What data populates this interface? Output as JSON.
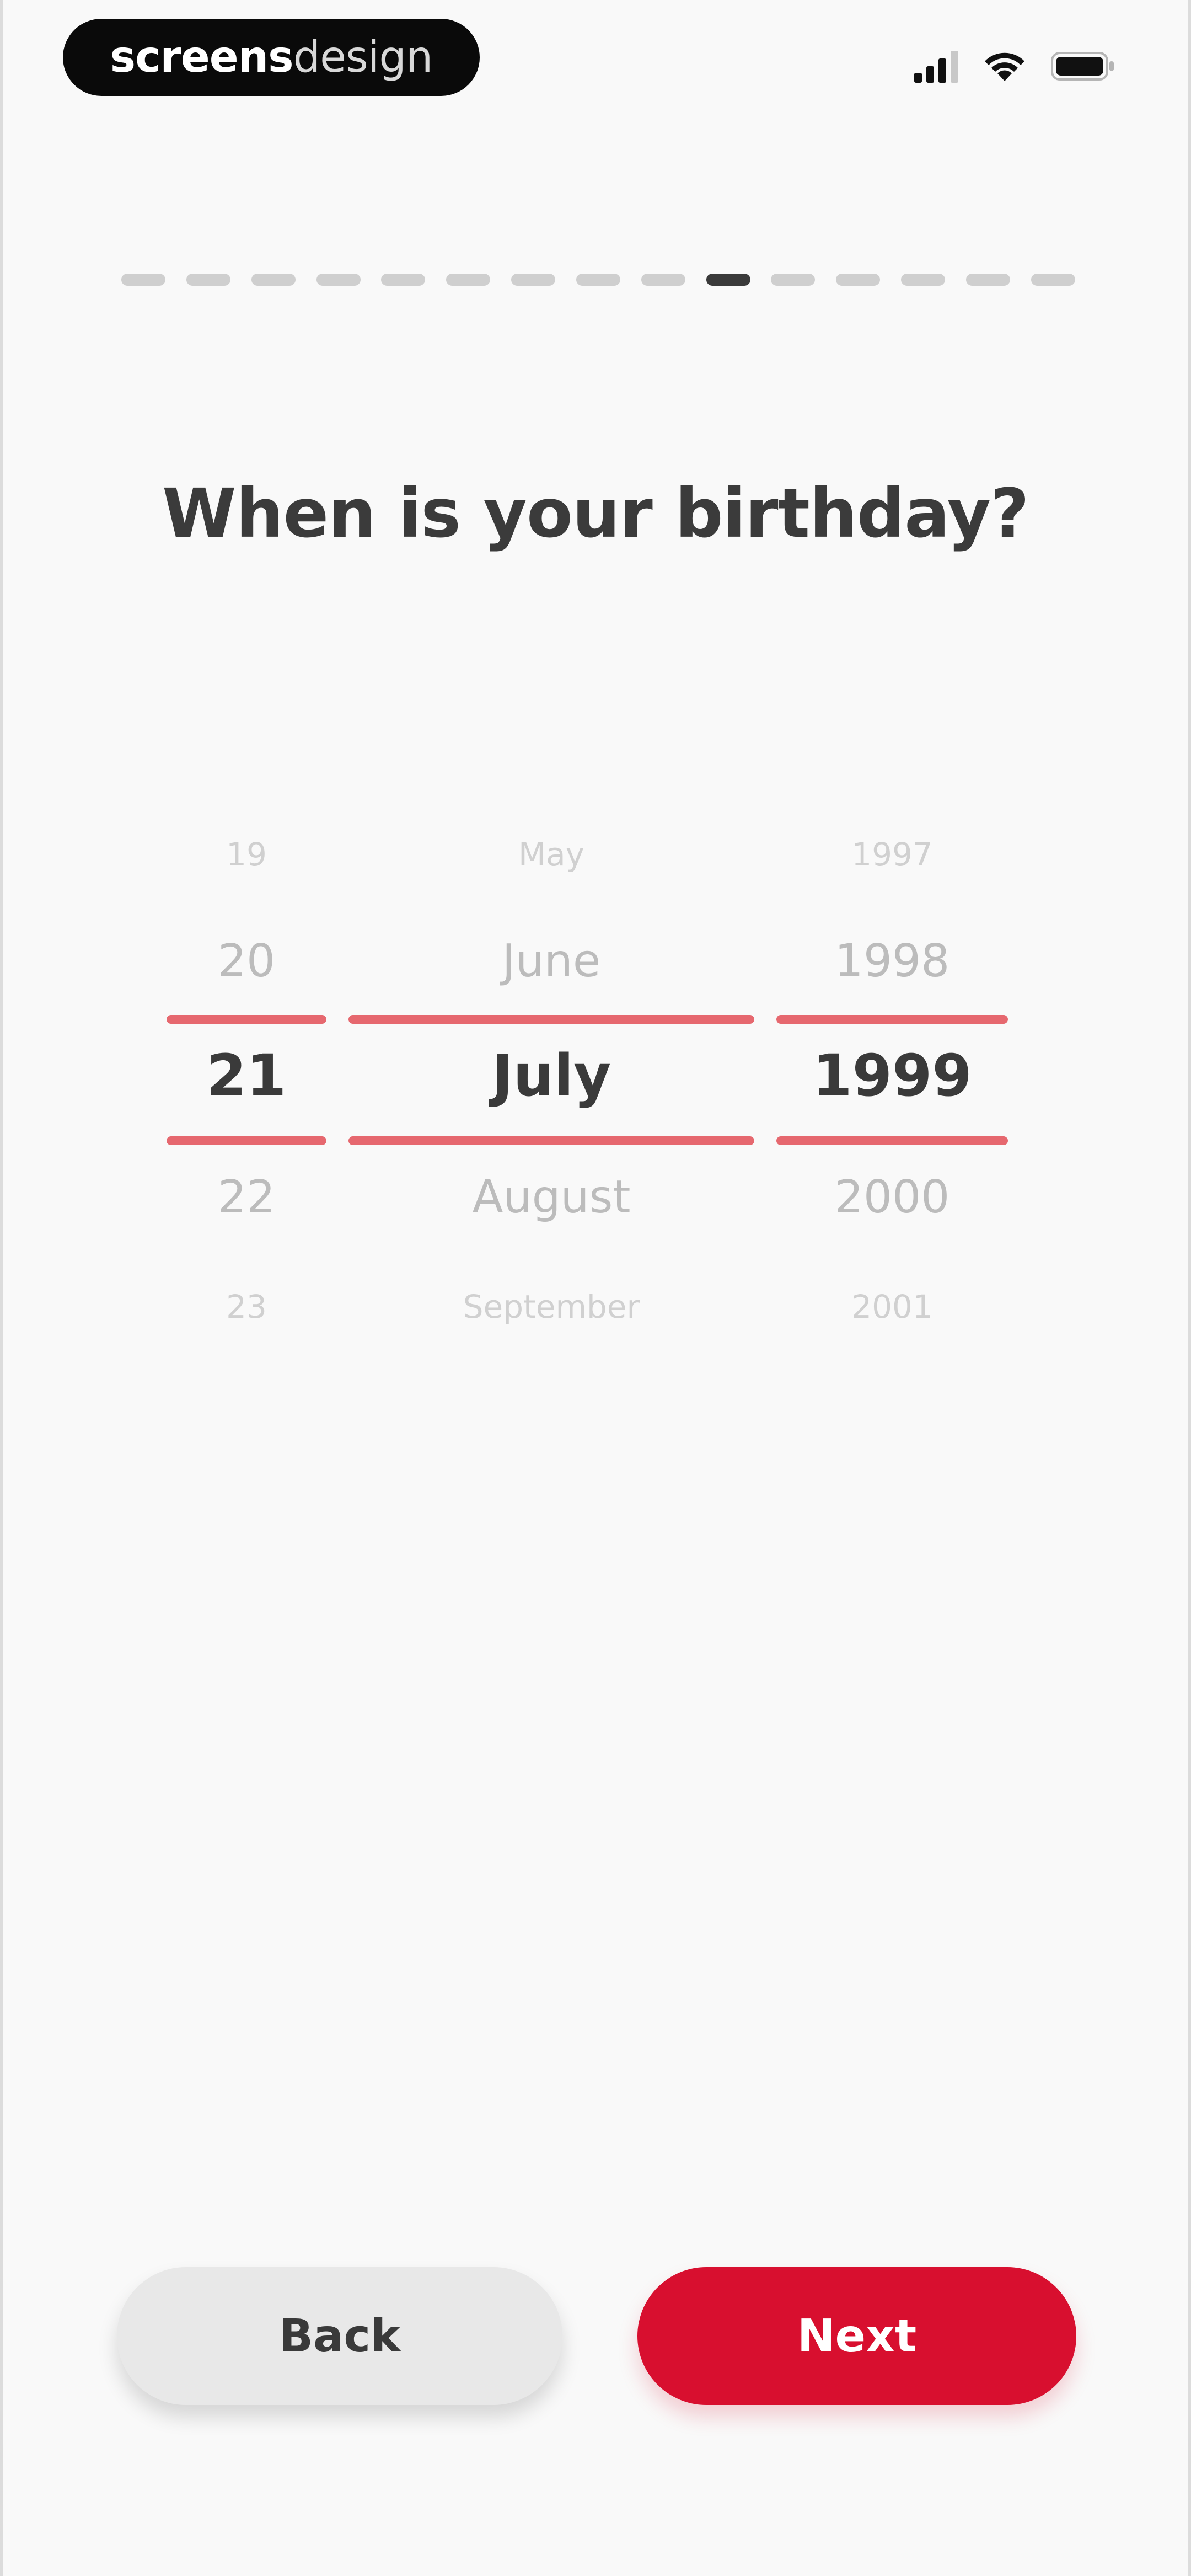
{
  "status_bar": {
    "brand_bold": "screens",
    "brand_light": "design",
    "signal_icon": "cellular-signal-icon",
    "wifi_icon": "wifi-icon",
    "battery_icon": "battery-icon"
  },
  "progress": {
    "total_steps": 15,
    "current_step": 10
  },
  "title": "When is your birthday?",
  "picker": {
    "day": [
      "19",
      "20",
      "21",
      "22",
      "23"
    ],
    "month": [
      "May",
      "June",
      "July",
      "August",
      "September"
    ],
    "year": [
      "1997",
      "1998",
      "1999",
      "2000",
      "2001"
    ],
    "selected": {
      "day": "21",
      "month": "July",
      "year": "1999"
    }
  },
  "buttons": {
    "back_label": "Back",
    "next_label": "Next"
  },
  "colors": {
    "accent": "#d80f2f",
    "selection_line": "#e6686f",
    "progress_active": "#3a3a3a",
    "progress_inactive": "#cfcfcf"
  }
}
